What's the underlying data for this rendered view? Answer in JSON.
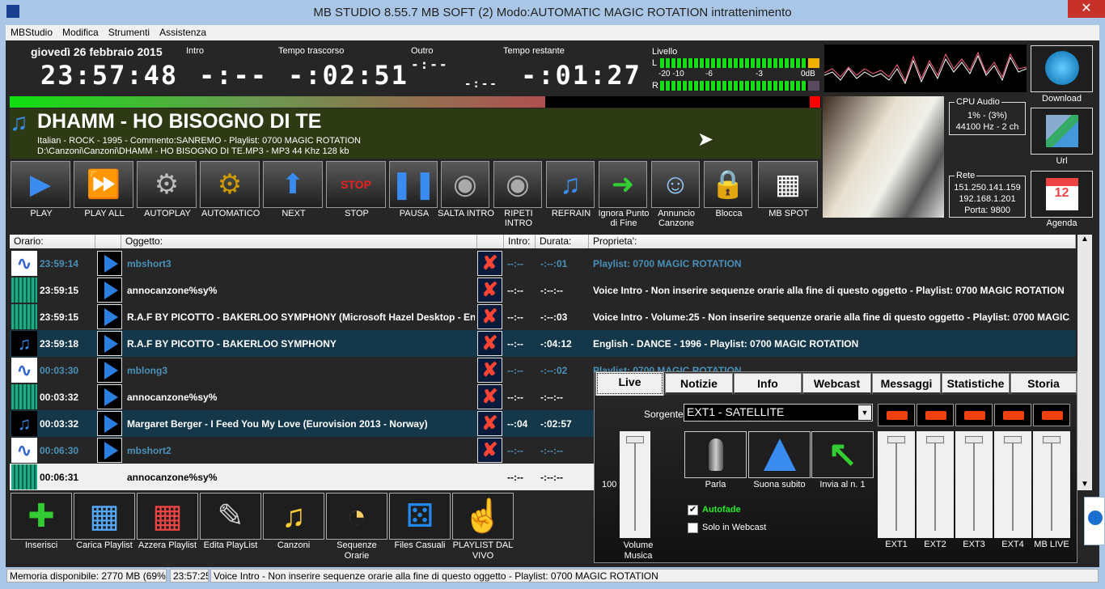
{
  "window": {
    "title": "MB STUDIO  8.55.7  MB SOFT (2)  Modo:AUTOMATIC  MAGIC ROTATION  intrattenimento",
    "close": "✕"
  },
  "menu": [
    "MBStudio",
    "Modifica",
    "Strumenti",
    "Assistenza"
  ],
  "clock": {
    "date": "giovedì 26 febbraio 2015",
    "time": "23:57:48"
  },
  "timers": {
    "intro_label": "Intro",
    "intro": "-:--",
    "elapsed_label": "Tempo trascorso",
    "elapsed": "-:02:51",
    "outro_label": "Outro",
    "outro": "-:--",
    "outro2": "-:--",
    "remaining_label": "Tempo restante",
    "remaining": "-:01:27"
  },
  "level": {
    "label": "Livello",
    "L": "L",
    "R": "R",
    "scale": [
      "-20",
      "-10",
      "-6",
      "-3",
      "0dB"
    ]
  },
  "progress_percent": 66,
  "now_playing": {
    "title": "DHAMM - HO BISOGNO DI TE",
    "info": "Italian - ROCK - 1995 - Commento:SANREMO - Playlist: 0700  MAGIC ROTATION",
    "path": "D:\\Canzoni\\Canzoni\\DHAMM - HO BISOGNO DI TE.MP3 - MP3 44 Khz 128 kb"
  },
  "toolbar": [
    "PLAY",
    "PLAY ALL",
    "AUTOPLAY",
    "AUTOMATICO",
    "NEXT",
    "STOP",
    "PAUSA",
    "SALTA INTRO",
    "RIPETI INTRO",
    "REFRAIN",
    "Ignora Punto di Fine",
    "Annuncio Canzone",
    "Blocca",
    "MB SPOT"
  ],
  "cpu": {
    "label": "CPU Audio",
    "usage": "1% - (3%)",
    "format": "44100 Hz - 2 ch"
  },
  "net": {
    "label": "Rete",
    "ip1": "151.250.141.159",
    "ip2": "192.168.1.201",
    "port": "Porta: 9800"
  },
  "side_buttons": [
    "Download",
    "Url",
    "Agenda"
  ],
  "list": {
    "headers": {
      "time": "Orario:",
      "object": "Oggetto:",
      "intro": "Intro:",
      "duration": "Durata:",
      "props": "Proprieta':"
    },
    "rows": [
      {
        "time": "23:59:14",
        "object": "mbshort3",
        "intro": "--:--",
        "duration": "-:--:01",
        "props": "Playlist: 0700  MAGIC ROTATION",
        "type": "voice",
        "style": "dim"
      },
      {
        "time": "23:59:15",
        "object": "annocanzone%sy%",
        "intro": "--:--",
        "duration": "-:--:--",
        "props": "Voice Intro - Non inserire sequenze orarie alla fine di questo oggetto - Playlist: 0700  MAGIC ROTATION",
        "type": "wave",
        "style": "normal"
      },
      {
        "time": "23:59:15",
        "object": "R.A.F BY PICOTTO - BAKERLOO SYMPHONY (Microsoft Hazel Desktop - Eng...",
        "intro": "--:--",
        "duration": "-:--:03",
        "props": "Voice Intro - Volume:25 - Non inserire sequenze orarie alla fine di questo oggetto - Playlist: 0700  MAGIC...",
        "type": "wave",
        "style": "normal"
      },
      {
        "time": "23:59:18",
        "object": "R.A.F BY PICOTTO - BAKERLOO SYMPHONY",
        "intro": "--:--",
        "duration": "-:04:12",
        "props": "English - DANCE - 1996 - Playlist: 0700  MAGIC ROTATION",
        "type": "song",
        "style": "song"
      },
      {
        "time": "00:03:30",
        "object": "mblong3",
        "intro": "--:--",
        "duration": "-:--:02",
        "props": "Playlist: 0700  MAGIC ROTATION",
        "type": "voice",
        "style": "dim"
      },
      {
        "time": "00:03:32",
        "object": "annocanzone%sy%",
        "intro": "--:--",
        "duration": "-:--:--",
        "props": "",
        "type": "wave",
        "style": "normal"
      },
      {
        "time": "00:03:32",
        "object": "Margaret Berger - I Feed You My Love (Eurovision 2013 - Norway)",
        "intro": "--:04",
        "duration": "-:02:57",
        "props": "",
        "type": "song",
        "style": "song"
      },
      {
        "time": "00:06:30",
        "object": "mbshort2",
        "intro": "--:--",
        "duration": "-:--:--",
        "props": "",
        "type": "voice",
        "style": "dim"
      },
      {
        "time": "00:06:31",
        "object": "annocanzone%sy%",
        "intro": "--:--",
        "duration": "-:--:--",
        "props": "",
        "type": "wave",
        "style": "light"
      }
    ]
  },
  "bottom_buttons": [
    "Inserisci",
    "Carica Playlist",
    "Azzera Playlist",
    "Edita PlayList",
    "Canzoni",
    "Sequenze Orarie",
    "Files Casuali",
    "PLAYLIST DAL VIVO"
  ],
  "live": {
    "tabs": [
      "Live",
      "Notizie",
      "Info",
      "Webcast",
      "Messaggi",
      "Statistiche",
      "Storia"
    ],
    "source_label": "Sorgente:",
    "source": "EXT1 - SATELLITE",
    "volume_value": "100",
    "volume_label": "Volume Musica",
    "actions": [
      "Parla",
      "Suona subito",
      "Invia al n. 1"
    ],
    "autofade": {
      "label": "Autofade",
      "checked": true
    },
    "webcast_only": {
      "label": "Solo in Webcast",
      "checked": false
    },
    "channels": [
      "EXT1",
      "EXT2",
      "EXT3",
      "EXT4",
      "MB LIVE"
    ]
  },
  "status": {
    "memory": "Memoria disponibile: 2770 MB (69%)",
    "time": "23:57:25",
    "message": "Voice Intro - Non inserire sequenze orarie alla fine di questo oggetto - Playlist: 0700  MAGIC ROTATION"
  }
}
